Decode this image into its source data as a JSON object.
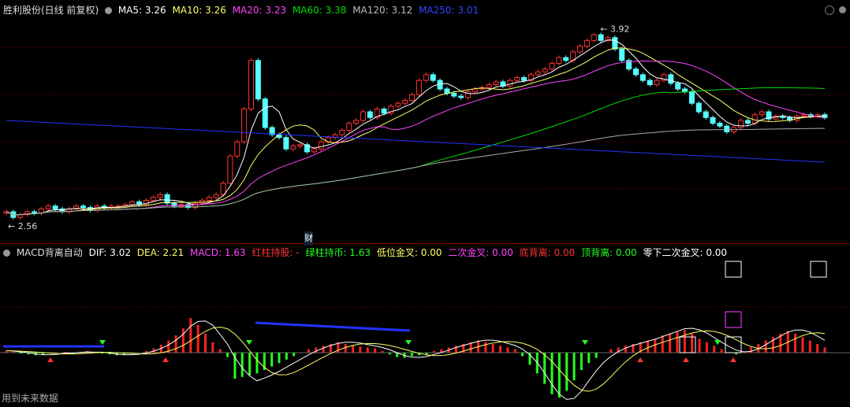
{
  "header": {
    "title": "胜利股份(日线 前复权)",
    "ma5": "MA5: 3.26",
    "ma10": "MA10: 3.26",
    "ma20": "MA20: 3.23",
    "ma60": "MA60: 3.38",
    "ma120": "MA120: 3.12",
    "ma250": "MA250: 3.01"
  },
  "macd_header": {
    "title": "MACD背离自动",
    "dif": "DIF: 3.02",
    "dea": "DEA: 2.21",
    "macd": "MACD: 1.63",
    "red_hold": "红柱持股: -",
    "green_hold": "绿柱持币: 1.63",
    "low_cross": "低位金叉: 0.00",
    "second_cross": "二次金叉: 0.00",
    "bottom_div": "底背离: 0.00",
    "top_div": "顶背离: 0.00",
    "below_zero_cross": "零下二次金叉: 0.00"
  },
  "footer_note": "用到未来数据",
  "finance_marker": "财",
  "colors": {
    "up": "#ff3333",
    "down": "#54ffff",
    "ma5": "#ffffff",
    "ma10": "#ffff66",
    "ma20": "#ff44ff",
    "ma60": "#00dd00",
    "ma120": "#aaaaaa",
    "ma250": "#2233ff",
    "macd_pos": "#ff2222",
    "macd_neg": "#22ff22"
  },
  "chart_data": {
    "type": "candlestick",
    "price_labels": {
      "high": "3.92",
      "low": "2.56"
    },
    "ylim": [
      2.5,
      4.0
    ],
    "closes": [
      2.66,
      2.62,
      2.64,
      2.66,
      2.65,
      2.68,
      2.7,
      2.68,
      2.66,
      2.68,
      2.7,
      2.69,
      2.67,
      2.7,
      2.69,
      2.7,
      2.7,
      2.71,
      2.73,
      2.71,
      2.74,
      2.76,
      2.78,
      2.72,
      2.7,
      2.71,
      2.69,
      2.72,
      2.74,
      2.76,
      2.78,
      2.86,
      3.05,
      3.15,
      3.38,
      3.72,
      3.45,
      3.25,
      3.2,
      3.18,
      3.1,
      3.12,
      3.13,
      3.08,
      3.1,
      3.15,
      3.18,
      3.2,
      3.23,
      3.28,
      3.3,
      3.36,
      3.32,
      3.38,
      3.35,
      3.4,
      3.42,
      3.44,
      3.48,
      3.58,
      3.62,
      3.58,
      3.52,
      3.49,
      3.47,
      3.46,
      3.5,
      3.52,
      3.53,
      3.55,
      3.57,
      3.54,
      3.58,
      3.6,
      3.58,
      3.62,
      3.64,
      3.66,
      3.7,
      3.74,
      3.72,
      3.78,
      3.82,
      3.86,
      3.9,
      3.86,
      3.88,
      3.8,
      3.72,
      3.66,
      3.62,
      3.58,
      3.55,
      3.58,
      3.62,
      3.56,
      3.52,
      3.5,
      3.42,
      3.36,
      3.32,
      3.28,
      3.26,
      3.22,
      3.25,
      3.3,
      3.28,
      3.34,
      3.36,
      3.31,
      3.33,
      3.32,
      3.3,
      3.33,
      3.34,
      3.33,
      3.34,
      3.32
    ],
    "macd_values": [
      0.02,
      0.01,
      -0.01,
      -0.02,
      -0.03,
      -0.02,
      -0.01,
      0.0,
      0.01,
      -0.01,
      0.01,
      0.02,
      0.0,
      -0.01,
      -0.02,
      -0.03,
      -0.02,
      -0.01,
      0.0,
      0.02,
      0.05,
      0.09,
      0.14,
      0.2,
      0.28,
      0.4,
      0.32,
      0.22,
      0.12,
      0.04,
      -0.05,
      -0.3,
      -0.28,
      -0.26,
      -0.24,
      -0.2,
      -0.16,
      -0.12,
      -0.08,
      -0.04,
      0.0,
      0.04,
      0.06,
      0.08,
      0.1,
      0.12,
      0.1,
      0.08,
      0.07,
      0.06,
      0.05,
      0.02,
      -0.02,
      -0.05,
      -0.06,
      -0.04,
      -0.03,
      -0.02,
      0.02,
      0.04,
      0.06,
      0.08,
      0.1,
      0.12,
      0.14,
      0.12,
      0.1,
      0.08,
      0.06,
      0.04,
      -0.04,
      -0.14,
      -0.24,
      -0.36,
      -0.48,
      -0.52,
      -0.44,
      -0.32,
      -0.2,
      -0.12,
      -0.06,
      0.0,
      0.04,
      0.06,
      0.08,
      0.1,
      0.12,
      0.14,
      0.16,
      0.2,
      0.22,
      0.24,
      0.26,
      0.22,
      0.16,
      0.12,
      0.08,
      0.04,
      0.0,
      -0.02,
      0.01,
      0.06,
      0.1,
      0.14,
      0.18,
      0.22,
      0.25,
      0.22,
      0.18,
      0.14,
      0.1,
      0.06
    ]
  }
}
